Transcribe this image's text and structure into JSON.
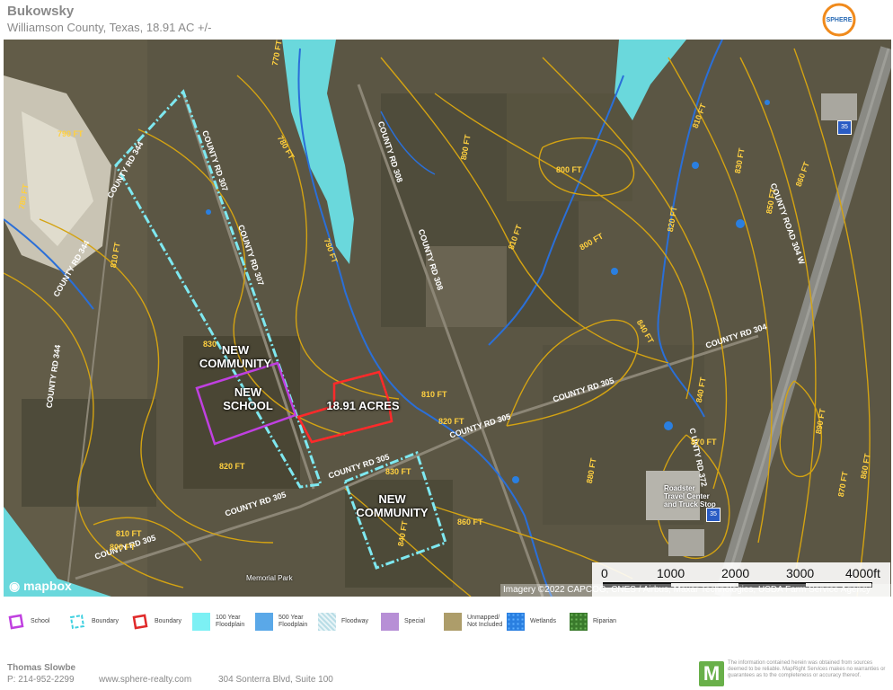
{
  "header": {
    "title": "Bukowsky",
    "subtitle": "Williamson County, Texas, 18.91 AC +/-",
    "logo_text": "SPHERE"
  },
  "map": {
    "labels": {
      "community_west": "NEW\nCOMMUNITY",
      "school": "NEW\nSCHOOL",
      "acres": "18.91 ACRES",
      "community_south": "NEW\nCOMMUNITY"
    },
    "roads": {
      "cr344_a": "COUNTY RD 344",
      "cr344_b": "COUNTY RD 344",
      "cr344_c": "COUNTY RD 344",
      "cr307": "COUNTY RD 307",
      "cr307_b": "COUNTY RD 307",
      "cr308": "COUNTY RD 308",
      "cr308_b": "COUNTY RD 308",
      "cr305_a": "COUNTY RD 305",
      "cr305_b": "COUNTY RD 305",
      "cr305_c": "COUNTY RD 305",
      "cr304w": "COUNTY ROAD 304 W",
      "cr304": "COUNTY RD 304",
      "cr372": "C UNTY RD 372",
      "cr305_d": "COUNTY RD 305"
    },
    "contours": {
      "c780": "780 FT",
      "c790": "790 FT",
      "c800": "800 FT",
      "c810": "810 FT",
      "c820": "820 FT",
      "c830": "830 FT",
      "c840": "840 FT",
      "c850": "850 FT",
      "c860": "860 FT",
      "c870": "870 FT",
      "c880": "880 FT",
      "c890": "890 FT",
      "c830b": "830",
      "c770": "770 FT"
    },
    "places": {
      "roadster": "Roadster\nTravel Center\nand Truck Stop",
      "memorial": "Memorial Park",
      "i35": "35"
    },
    "scale": [
      "0",
      "1000",
      "2000",
      "3000",
      "4000ft"
    ],
    "attribution": "Imagery ©2022 CAPCOG, CNES / Airbus, Maxar Technologies, USDA Farm Service Agency",
    "mapbox": "mapbox"
  },
  "legend": [
    {
      "label": "School",
      "swatch": "school"
    },
    {
      "label": "Boundary",
      "swatch": "boundary-cyan"
    },
    {
      "label": "Boundary",
      "swatch": "boundary-red"
    },
    {
      "label": "100 Year\nFloodplain",
      "swatch": "fp100"
    },
    {
      "label": "500 Year\nFloodplain",
      "swatch": "fp500"
    },
    {
      "label": "Floodway",
      "swatch": "floodway"
    },
    {
      "label": "Special",
      "swatch": "special"
    },
    {
      "label": "Unmapped/\nNot Included",
      "swatch": "unmapped"
    },
    {
      "label": "Wetlands",
      "swatch": "wetlands"
    },
    {
      "label": "Riparian",
      "swatch": "riparian"
    }
  ],
  "colors": {
    "school": "#c040e0",
    "boundary_cyan": "#7ee8f0",
    "boundary_red": "#ff2a2a",
    "fp100": "#7cf0f4",
    "fp500": "#5aa8e8",
    "floodway": "#b9dde6",
    "special": "#b78fd6",
    "unmapped": "#ad9d6a",
    "wetlands": "#2a7fe0",
    "riparian": "#4a8f3a",
    "contour": "#d4a312"
  },
  "footer": {
    "agent": "Thomas Slowbe",
    "phone": "P: 214-952-2299",
    "website": "www.sphere-realty.com",
    "address": "304 Sonterra Blvd, Suite 100",
    "disclaimer": "The information contained herein was obtained from sources deemed to be reliable. MapRight Services makes no warranties or guarantees as to the completeness or accuracy thereof."
  }
}
